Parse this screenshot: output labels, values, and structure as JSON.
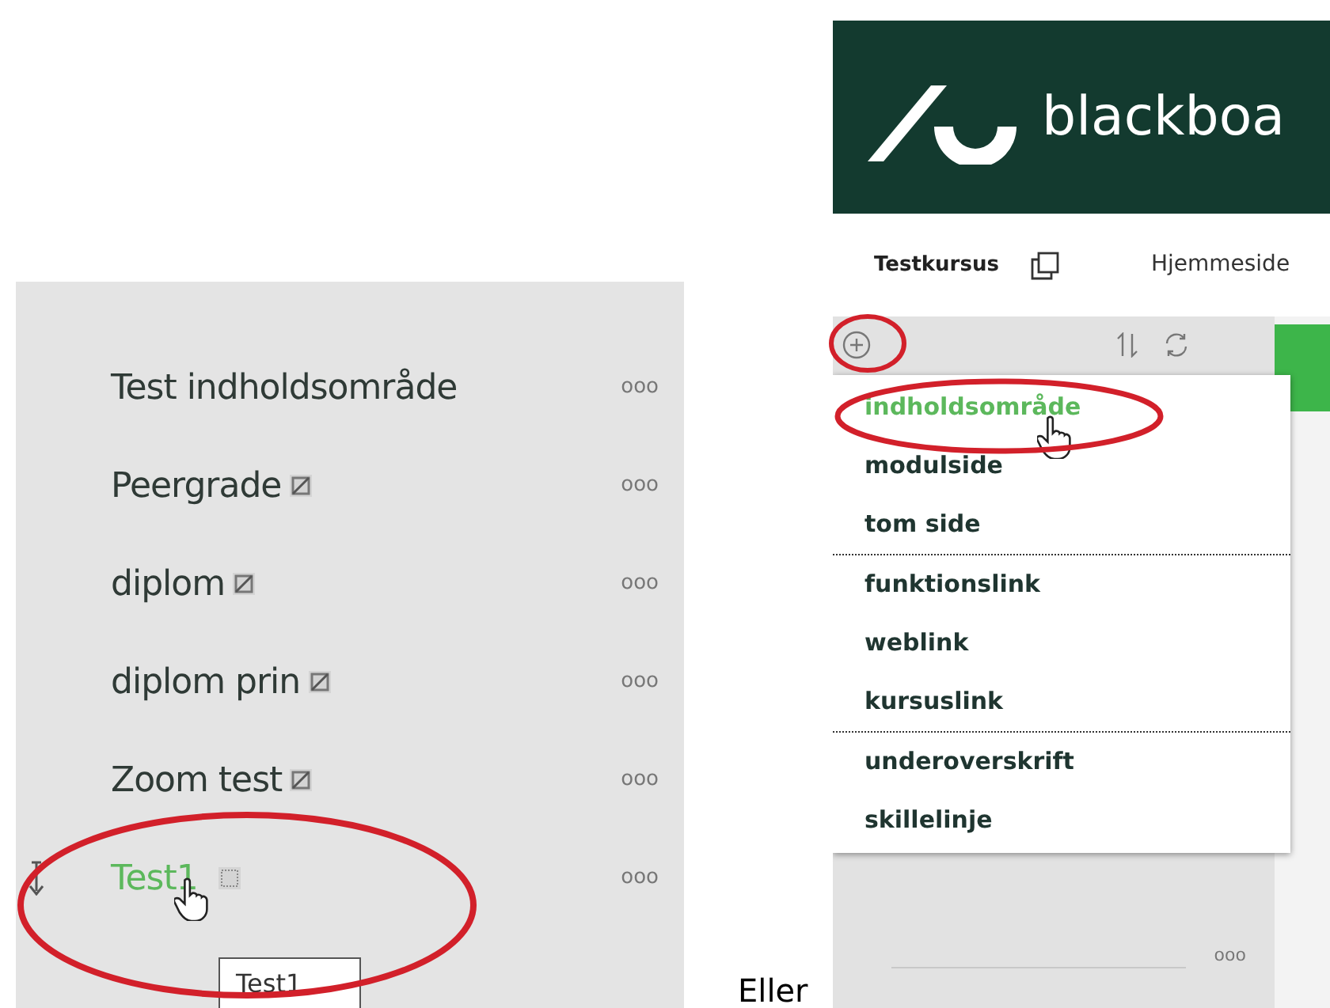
{
  "left_panel": {
    "items": [
      {
        "label": "Test indholdsområde",
        "kind": "plain",
        "selected": false,
        "more": "ooo"
      },
      {
        "label": "Peergrade",
        "kind": "hidden",
        "selected": false,
        "more": "ooo"
      },
      {
        "label": "diplom",
        "kind": "hidden",
        "selected": false,
        "more": "ooo"
      },
      {
        "label": "diplom prin",
        "kind": "hidden",
        "selected": false,
        "more": "ooo"
      },
      {
        "label": "Zoom test",
        "kind": "hidden",
        "selected": false,
        "more": "ooo"
      },
      {
        "label": "Test1",
        "kind": "empty",
        "selected": true,
        "more": "ooo"
      }
    ],
    "tooltip": "Test1"
  },
  "caption": "Eller",
  "right_panel": {
    "brand": "blackboa",
    "course": "Testkursus",
    "nav_link": "Hjemmeside",
    "menu": {
      "groups": [
        [
          {
            "label": "indholdsområde",
            "selected": true
          },
          {
            "label": "modulside",
            "selected": false
          },
          {
            "label": "tom side",
            "selected": false
          }
        ],
        [
          {
            "label": "funktionslink",
            "selected": false
          },
          {
            "label": "weblink",
            "selected": false
          },
          {
            "label": "kursuslink",
            "selected": false
          }
        ],
        [
          {
            "label": "underoverskrift",
            "selected": false
          },
          {
            "label": "skillelinje",
            "selected": false
          }
        ]
      ]
    },
    "below_row": {
      "more": "ooo"
    }
  }
}
